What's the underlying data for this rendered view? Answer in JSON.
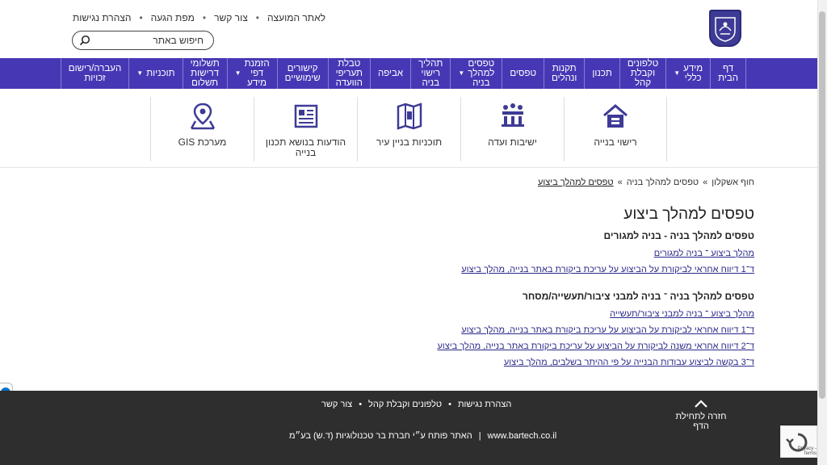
{
  "top_links": [
    "לאתר המועצה",
    "צור קשר",
    "מפת הגעה",
    "הצהרת נגישות"
  ],
  "search": {
    "placeholder": "חיפוש באתר"
  },
  "nav": [
    {
      "label": "דף\nהבית",
      "dropdown": false
    },
    {
      "label": "מידע\nכללי",
      "dropdown": true
    },
    {
      "label": "טלפונים\nוקבלת\nקהל",
      "dropdown": false
    },
    {
      "label": "תכנון",
      "dropdown": false
    },
    {
      "label": "תקנות\nונהלים",
      "dropdown": false
    },
    {
      "label": "טפסים",
      "dropdown": false
    },
    {
      "label": "טפסים\nלמהלך\nבניה",
      "dropdown": true
    },
    {
      "label": "תהליך\nרישוי\nבניה",
      "dropdown": false
    },
    {
      "label": "אביפה",
      "dropdown": false
    },
    {
      "label": "טבלת\nתעריפי\nהוועדה",
      "dropdown": false
    },
    {
      "label": "קישורים\nשימושיים",
      "dropdown": false
    },
    {
      "label": "הזמנת\nדפי\nמידע",
      "dropdown": true
    },
    {
      "label": "תשלומי\nדרישות\nתשלום",
      "dropdown": false
    },
    {
      "label": "תוכניות",
      "dropdown": true
    },
    {
      "label": "העברה/רישום\nזכויות",
      "dropdown": false
    }
  ],
  "tiles": [
    {
      "label": "רישוי בנייה",
      "icon": "house-icon"
    },
    {
      "label": "ישיבות ועדה",
      "icon": "meeting-icon"
    },
    {
      "label": "תוכניות בניין עיר",
      "icon": "map-book-icon"
    },
    {
      "label": "הודעות בנושא תכנון\nבנייה",
      "icon": "notice-board-icon"
    },
    {
      "label": "מערכת GIS",
      "icon": "map-pin-icon"
    }
  ],
  "breadcrumb": {
    "home": "חוף אשקלון",
    "sep": "»",
    "parent": "טפסים למהלך בניה",
    "current": "טפסים למהלך ביצוע"
  },
  "content": {
    "title": "טפסים למהלך ביצוע",
    "section1_title": "טפסים למהלך בניה - בניה למגורים",
    "section1_links": [
      "מהלך ביצוע ־ בניה למגורים",
      "ד־1 דיווח אחראי לביקורת על הביצוע על עריכת ביקורת באתר בנייה, מהלך ביצוע"
    ],
    "section2_title": "טפסים למהלך בניה ־ בניה למבני ציבור/תעשייה/מסחר",
    "section2_links": [
      "מהלך ביצוע ־ בניה למבני ציבור/תעשייה",
      "ד־1 דיווח אחראי לביקורת על הביצוע על עריכת ביקורת באתר בנייה, מהלך ביצוע",
      "ד־2 דיווח אחראי משנה לביקורת על הביצוע על עריכת ביקורת באתר בנייה, מהלך ביצוע",
      "ד־3 בקשה לביצוע עבודות הבנייה על פי ההיתר בשלבים, מהלך ביצוע"
    ]
  },
  "footer": {
    "links": [
      "הצהרת נגישות",
      "טלפונים וקבלת קהל",
      "צור קשר"
    ],
    "credit_site": "www.bartech.co.il",
    "credit_text": "האתר פותח ע״י חברת בר טכנולוגיות (ד.ש) בע״מ",
    "back_to_top": "חזרה לתחילת הדף"
  },
  "recaptcha": "Privacy - Terms",
  "colors": {
    "nav_bg": "#4638b5",
    "footer_bg": "#2e2e2e",
    "link": "#2a2a8a"
  }
}
